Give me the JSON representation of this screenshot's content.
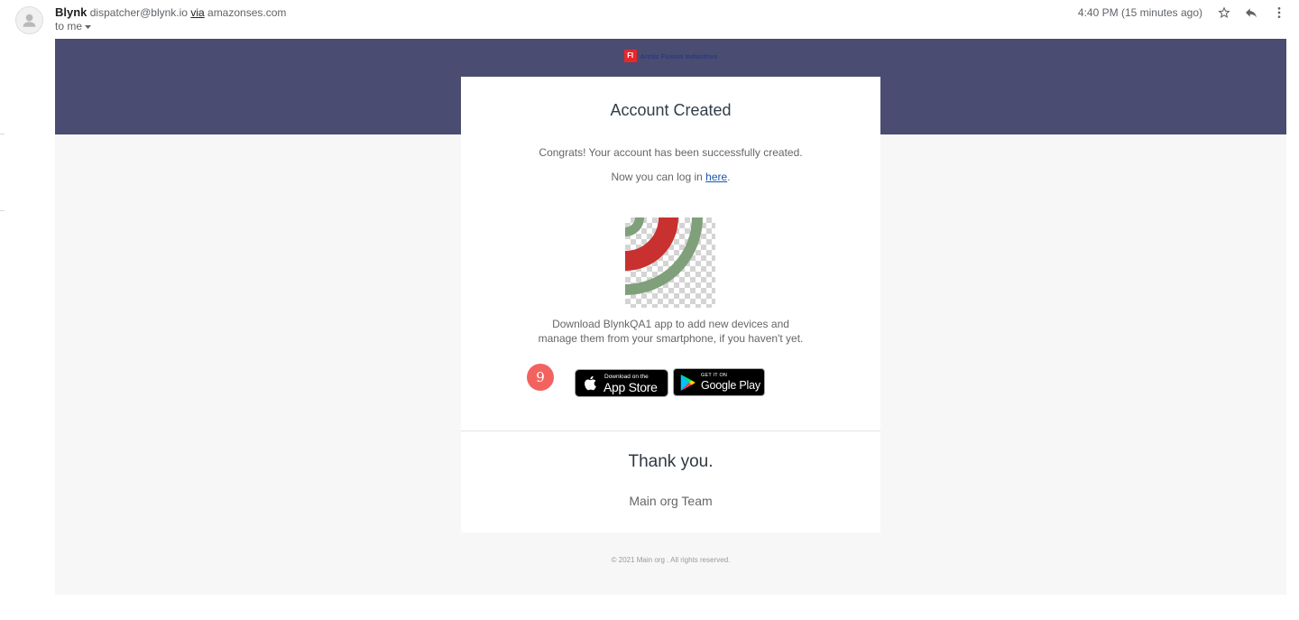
{
  "header": {
    "sender_name": "Blynk",
    "sender_email": "dispatcher@blynk.io",
    "via_label": "via",
    "via_domain": "amazonses.com",
    "recipient": "to me",
    "timestamp": "4:40 PM (15 minutes ago)",
    "icons": {
      "avatar": "person-icon",
      "recipient_menu": "caret-down-icon",
      "star": "star-icon",
      "reply": "reply-icon",
      "more": "more-vert-icon"
    }
  },
  "banner": {
    "logo_mark": "FI",
    "logo_text": "Arctic Fusion Industries"
  },
  "card": {
    "title": "Account Created",
    "congrats": "Congrats! Your account has been successfully created.",
    "login_prefix": "Now you can log in ",
    "login_link": "here",
    "login_suffix": ".",
    "download_lines": [
      "Download BlynkQA1 app to add new devices and",
      "manage them from your smartphone, if you haven't yet."
    ],
    "step_marker": "9",
    "app_store": {
      "caption": "Download on the",
      "name": "App Store",
      "icon": "apple-icon"
    },
    "google_play": {
      "caption": "GET IT ON",
      "name": "Google Play",
      "icon": "google-play-icon"
    },
    "thank_you": "Thank you.",
    "team": "Main org Team"
  },
  "footer": {
    "copyright": "© 2021 Main org . All rights reserved."
  },
  "colors": {
    "banner": "#4b4c72",
    "email_background": "#f7f7f8",
    "card_background": "#ffffff",
    "link": "#1a55b3",
    "logo_red": "#e8262b",
    "step_marker": "#f26360",
    "app_icon_red": "#c8312f",
    "app_icon_green": "#7fa07a"
  }
}
